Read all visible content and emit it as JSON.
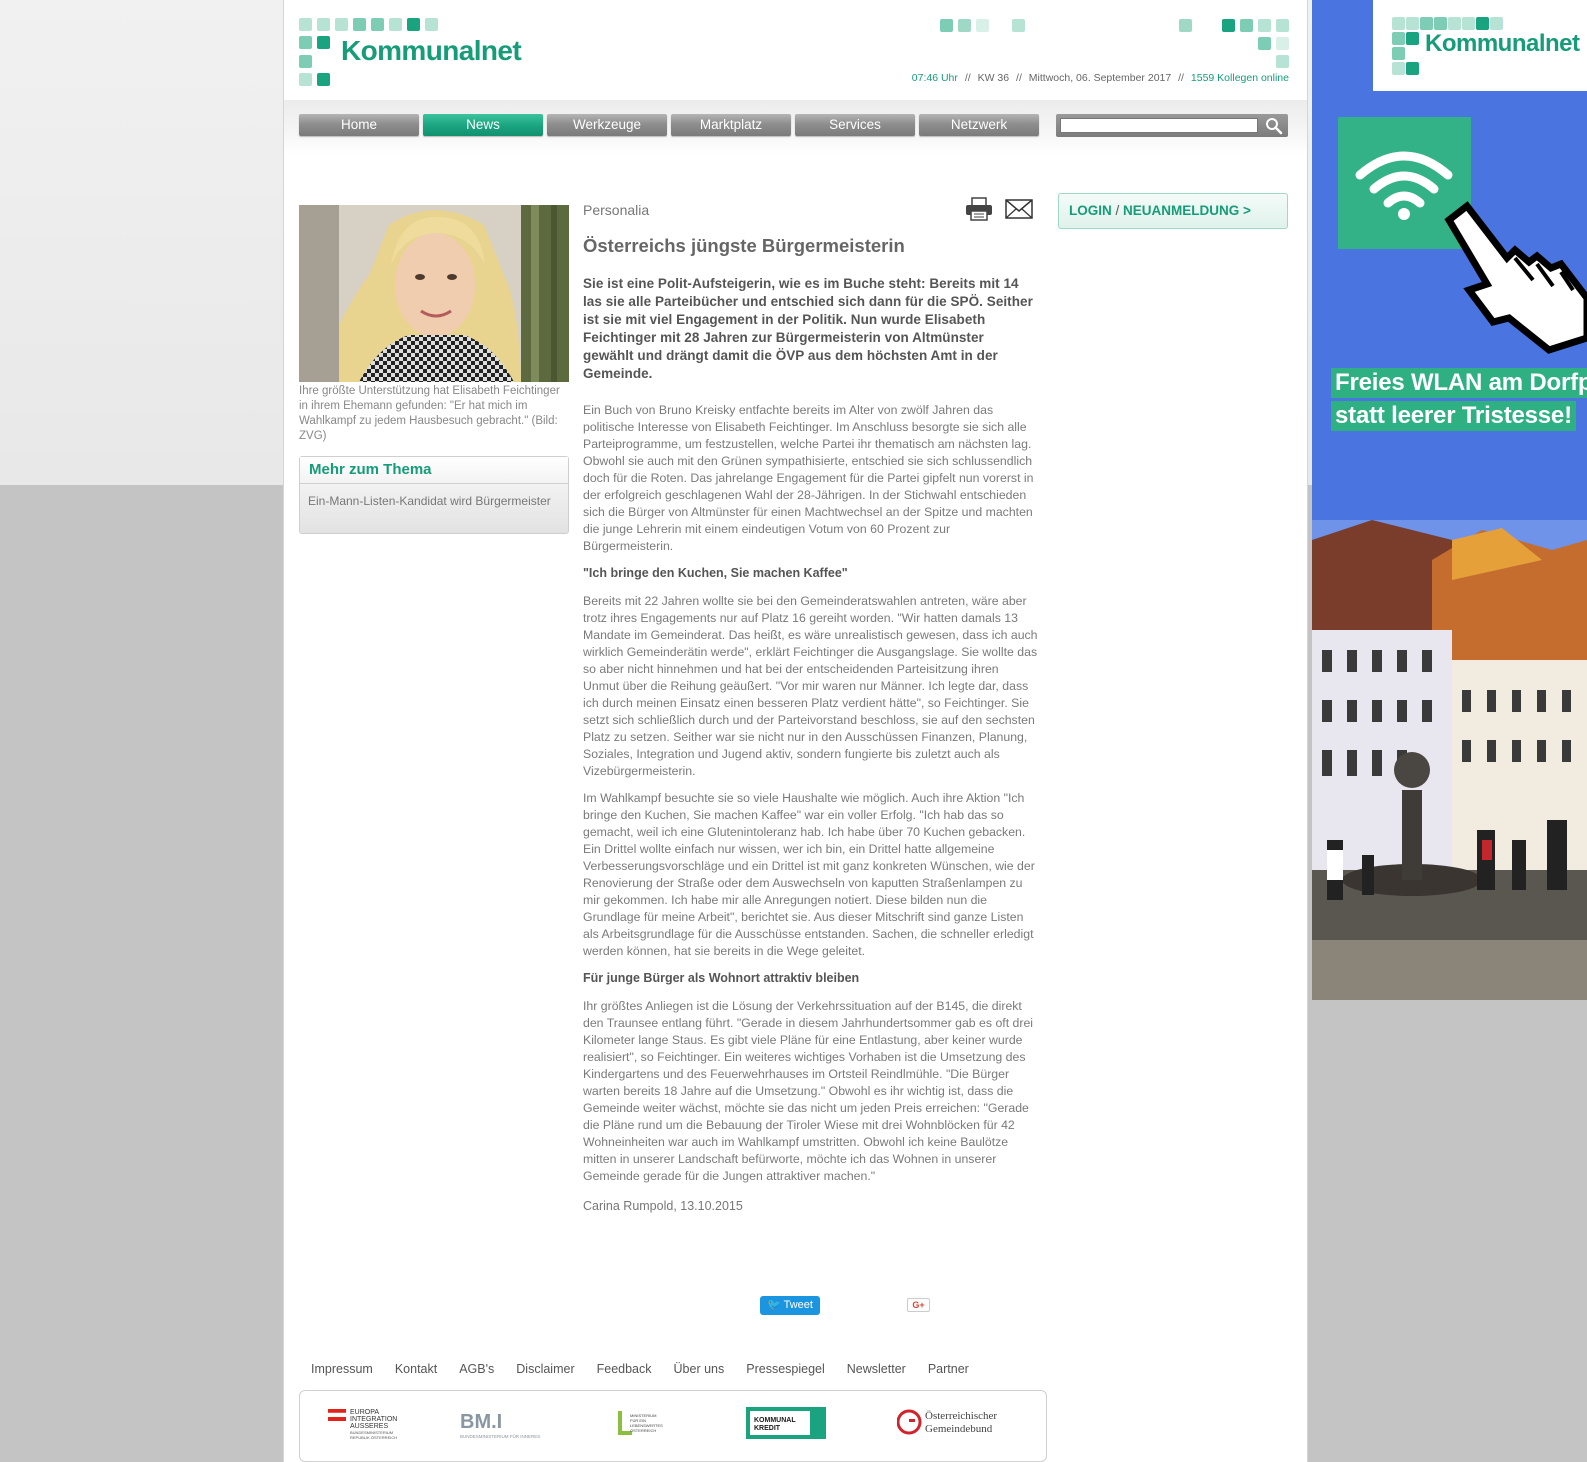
{
  "header": {
    "logo_text": "Kommunalnet",
    "time": "07:46 Uhr",
    "week": "KW 36",
    "date": "Mittwoch, 06. September 2017",
    "online": "1559 Kollegen online",
    "separator": "//"
  },
  "nav": {
    "items": [
      "Home",
      "News",
      "Werkzeuge",
      "Marktplatz",
      "Services",
      "Netzwerk"
    ],
    "active": "News"
  },
  "search": {
    "value": "",
    "placeholder": ""
  },
  "sidebar": {
    "caption": "Ihre größte Unterstützung hat Elisabeth Feichtinger in ihrem Ehemann gefunden: \"Er hat mich im Wahlkampf zu jedem Hausbesuch gebracht.\" (Bild: ZVG)",
    "mehr_title": "Mehr zum Thema",
    "mehr_link": "Ein-Mann-Listen-Kandidat wird Bürgermeister"
  },
  "article": {
    "kicker": "Personalia",
    "title": "Österreichs jüngste Bürgermeisterin",
    "lead": "Sie ist eine Polit-Aufsteigerin, wie es im Buche steht: Bereits mit 14 las sie alle Parteibücher und entschied sich dann für die SPÖ. Seither ist sie mit viel Engagement in der Politik. Nun wurde Elisabeth Feichtinger mit 28 Jahren zur Bürgermeisterin von Altmünster gewählt und drängt damit die ÖVP aus dem höchsten Amt in der Gemeinde.",
    "p1": "Ein Buch von Bruno Kreisky entfachte bereits im Alter von zwölf Jahren das politische Interesse von Elisabeth Feichtinger. Im Anschluss besorgte sie sich alle Parteiprogramme, um festzustellen, welche Partei ihr thematisch am nächsten lag. Obwohl sie auch mit den Grünen sympathisierte, entschied sie sich schlussendlich doch für die Roten. Das jahrelange Engagement für die Partei gipfelt nun vorerst in der erfolgreich geschlagenen Wahl der 28-Jährigen. In der Stichwahl entschieden sich die Bürger von Altmünster für einen Machtwechsel an der Spitze und machten die junge Lehrerin mit einem eindeutigen Votum von 60 Prozent zur Bürgermeisterin.",
    "h1": "\"Ich bringe den Kuchen, Sie machen Kaffee\"",
    "p2": "Bereits mit 22 Jahren wollte sie bei den Gemeinderatswahlen antreten, wäre aber trotz ihres Engagements nur auf Platz 16 gereiht worden. \"Wir hatten damals 13 Mandate im Gemeinderat. Das heißt, es wäre unrealistisch gewesen, dass ich auch wirklich Gemeinderätin werde\", erklärt Feichtinger die Ausgangslage. Sie wollte das so aber nicht hinnehmen und hat bei der entscheidenden Parteisitzung ihren Unmut über die Reihung geäußert. \"Vor mir waren nur Männer. Ich legte dar, dass ich durch meinen Einsatz einen besseren Platz verdient hätte\", so Feichtinger. Sie setzt sich schließlich durch und der Parteivorstand beschloss, sie auf den sechsten Platz zu setzen. Seither war sie nicht nur in den Ausschüssen Finanzen, Planung, Soziales, Integration und Jugend aktiv, sondern fungierte bis zuletzt auch als Vizebürgermeisterin.",
    "p3": "Im Wahlkampf besuchte sie so viele Haushalte wie möglich. Auch ihre Aktion \"Ich bringe den Kuchen, Sie machen Kaffee\" war ein voller Erfolg. \"Ich hab das so gemacht, weil ich eine Glutenintoleranz hab. Ich habe über 70 Kuchen gebacken. Ein Drittel wollte einfach nur wissen, wer ich bin, ein Drittel hatte allgemeine Verbesserungsvorschläge und ein Drittel ist mit ganz konkreten Wünschen, wie der Renovierung der Straße oder dem Auswechseln von kaputten Straßenlampen zu mir gekommen. Ich habe mir alle Anregungen notiert. Diese bilden nun die Grundlage für meine Arbeit\", berichtet sie. Aus dieser Mitschrift sind ganze Listen als Arbeitsgrundlage für die Ausschüsse entstanden. Sachen, die schneller erledigt werden können, hat sie bereits in die Wege geleitet.",
    "h2": "Für junge Bürger als Wohnort attraktiv bleiben",
    "p4": "Ihr größtes Anliegen ist die Lösung der Verkehrssituation auf der B145, die direkt den Traunsee entlang führt. \"Gerade in diesem Jahrhundertsommer gab es oft drei Kilometer lange Staus. Es gibt viele Pläne für eine Entlastung, aber keiner wurde realisiert\", so Feichtinger. Ein weiteres wichtiges Vorhaben ist die Umsetzung des Kindergartens und des Feuerwehrhauses im Ortsteil Reindlmühle. \"Die Bürger warten bereits 18 Jahre auf die Umsetzung.\" Obwohl es ihr wichtig ist, dass die Gemeinde weiter wächst, möchte sie das nicht um jeden Preis erreichen: \"Gerade die Pläne rund um die Bebauung der Tiroler Wiese mit drei Wohnblöcken für 42 Wohneinheiten war auch im Wahlkampf umstritten. Obwohl ich keine Baulötze mitten in unserer Landschaft befürworte, möchte ich das Wohnen in unserer Gemeinde gerade für die Jungen attraktiver machen.\"",
    "author": "Carina Rumpold, 13.10.2015"
  },
  "login": {
    "login": "LOGIN",
    "slash": " / ",
    "register": "NEUANMELDUNG >"
  },
  "social": {
    "tweet": "Tweet",
    "gplus": "G+"
  },
  "footer": {
    "links": [
      "Impressum",
      "Kontakt",
      "AGB's",
      "Disclaimer",
      "Feedback",
      "Über uns",
      "Pressespiegel",
      "Newsletter",
      "Partner"
    ],
    "partners": {
      "europa": [
        "EUROPA",
        "INTEGRATION",
        "AUSSERES"
      ],
      "europa_small": [
        "BUNDESMINISTERIUM",
        "REPUBLIK ÖSTERREICH"
      ],
      "bmi": "BM.I",
      "bmi_small": "BUNDESMINISTERIUM FÜR INNERES",
      "lebensministerium": [
        "MINISTERIUM",
        "FÜR EIN",
        "LEBENSWERTES",
        "ÖSTERREICH"
      ],
      "kommunalkredit": [
        "KOMMUNAL",
        "KREDIT"
      ],
      "gemeindebund": [
        "Österreichischer",
        "Gemeindebund"
      ]
    }
  },
  "ad": {
    "logo_text": "Kommunalnet",
    "line1": "Freies WLAN am Dorfp",
    "line2": "statt leerer Tristesse!"
  },
  "colors": {
    "brand_green": "#1aa37f",
    "nav_gray": "#8e8e8e",
    "ad_blue": "#4a74e0"
  }
}
